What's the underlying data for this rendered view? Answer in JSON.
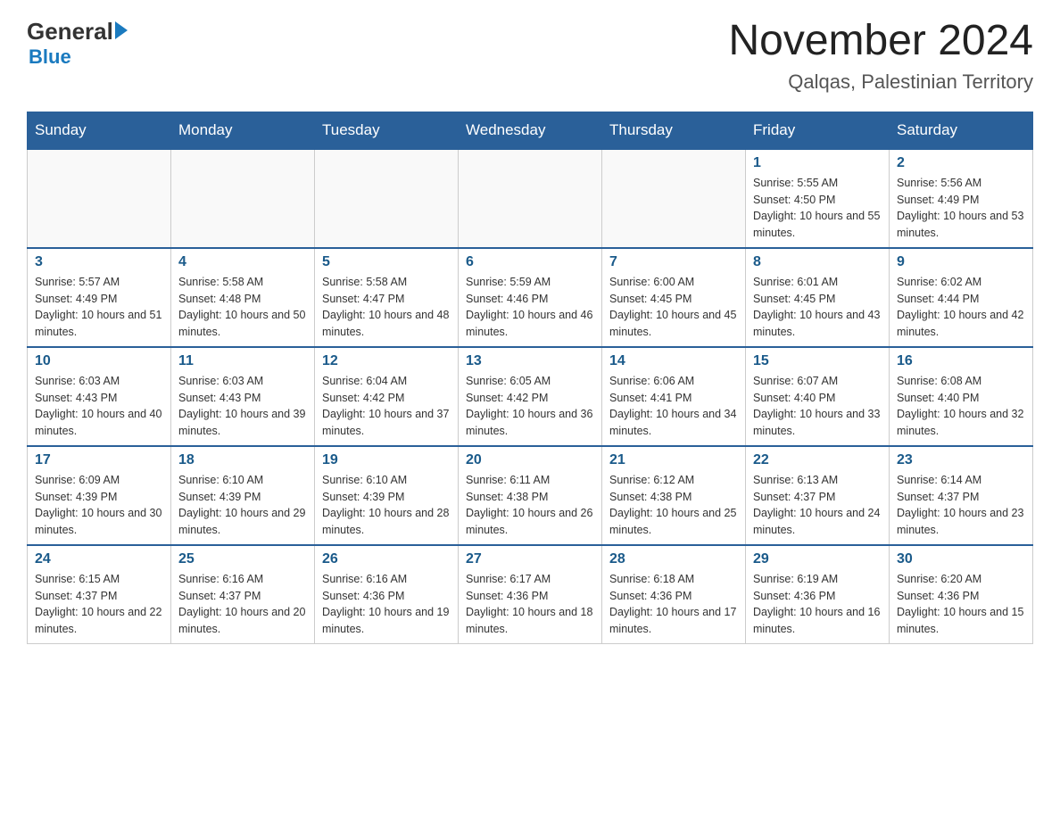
{
  "header": {
    "logo_general": "General",
    "logo_blue": "Blue",
    "title": "November 2024",
    "subtitle": "Qalqas, Palestinian Territory"
  },
  "calendar": {
    "days_of_week": [
      "Sunday",
      "Monday",
      "Tuesday",
      "Wednesday",
      "Thursday",
      "Friday",
      "Saturday"
    ],
    "weeks": [
      [
        {
          "day": "",
          "sunrise": "",
          "sunset": "",
          "daylight": ""
        },
        {
          "day": "",
          "sunrise": "",
          "sunset": "",
          "daylight": ""
        },
        {
          "day": "",
          "sunrise": "",
          "sunset": "",
          "daylight": ""
        },
        {
          "day": "",
          "sunrise": "",
          "sunset": "",
          "daylight": ""
        },
        {
          "day": "",
          "sunrise": "",
          "sunset": "",
          "daylight": ""
        },
        {
          "day": "1",
          "sunrise": "Sunrise: 5:55 AM",
          "sunset": "Sunset: 4:50 PM",
          "daylight": "Daylight: 10 hours and 55 minutes."
        },
        {
          "day": "2",
          "sunrise": "Sunrise: 5:56 AM",
          "sunset": "Sunset: 4:49 PM",
          "daylight": "Daylight: 10 hours and 53 minutes."
        }
      ],
      [
        {
          "day": "3",
          "sunrise": "Sunrise: 5:57 AM",
          "sunset": "Sunset: 4:49 PM",
          "daylight": "Daylight: 10 hours and 51 minutes."
        },
        {
          "day": "4",
          "sunrise": "Sunrise: 5:58 AM",
          "sunset": "Sunset: 4:48 PM",
          "daylight": "Daylight: 10 hours and 50 minutes."
        },
        {
          "day": "5",
          "sunrise": "Sunrise: 5:58 AM",
          "sunset": "Sunset: 4:47 PM",
          "daylight": "Daylight: 10 hours and 48 minutes."
        },
        {
          "day": "6",
          "sunrise": "Sunrise: 5:59 AM",
          "sunset": "Sunset: 4:46 PM",
          "daylight": "Daylight: 10 hours and 46 minutes."
        },
        {
          "day": "7",
          "sunrise": "Sunrise: 6:00 AM",
          "sunset": "Sunset: 4:45 PM",
          "daylight": "Daylight: 10 hours and 45 minutes."
        },
        {
          "day": "8",
          "sunrise": "Sunrise: 6:01 AM",
          "sunset": "Sunset: 4:45 PM",
          "daylight": "Daylight: 10 hours and 43 minutes."
        },
        {
          "day": "9",
          "sunrise": "Sunrise: 6:02 AM",
          "sunset": "Sunset: 4:44 PM",
          "daylight": "Daylight: 10 hours and 42 minutes."
        }
      ],
      [
        {
          "day": "10",
          "sunrise": "Sunrise: 6:03 AM",
          "sunset": "Sunset: 4:43 PM",
          "daylight": "Daylight: 10 hours and 40 minutes."
        },
        {
          "day": "11",
          "sunrise": "Sunrise: 6:03 AM",
          "sunset": "Sunset: 4:43 PM",
          "daylight": "Daylight: 10 hours and 39 minutes."
        },
        {
          "day": "12",
          "sunrise": "Sunrise: 6:04 AM",
          "sunset": "Sunset: 4:42 PM",
          "daylight": "Daylight: 10 hours and 37 minutes."
        },
        {
          "day": "13",
          "sunrise": "Sunrise: 6:05 AM",
          "sunset": "Sunset: 4:42 PM",
          "daylight": "Daylight: 10 hours and 36 minutes."
        },
        {
          "day": "14",
          "sunrise": "Sunrise: 6:06 AM",
          "sunset": "Sunset: 4:41 PM",
          "daylight": "Daylight: 10 hours and 34 minutes."
        },
        {
          "day": "15",
          "sunrise": "Sunrise: 6:07 AM",
          "sunset": "Sunset: 4:40 PM",
          "daylight": "Daylight: 10 hours and 33 minutes."
        },
        {
          "day": "16",
          "sunrise": "Sunrise: 6:08 AM",
          "sunset": "Sunset: 4:40 PM",
          "daylight": "Daylight: 10 hours and 32 minutes."
        }
      ],
      [
        {
          "day": "17",
          "sunrise": "Sunrise: 6:09 AM",
          "sunset": "Sunset: 4:39 PM",
          "daylight": "Daylight: 10 hours and 30 minutes."
        },
        {
          "day": "18",
          "sunrise": "Sunrise: 6:10 AM",
          "sunset": "Sunset: 4:39 PM",
          "daylight": "Daylight: 10 hours and 29 minutes."
        },
        {
          "day": "19",
          "sunrise": "Sunrise: 6:10 AM",
          "sunset": "Sunset: 4:39 PM",
          "daylight": "Daylight: 10 hours and 28 minutes."
        },
        {
          "day": "20",
          "sunrise": "Sunrise: 6:11 AM",
          "sunset": "Sunset: 4:38 PM",
          "daylight": "Daylight: 10 hours and 26 minutes."
        },
        {
          "day": "21",
          "sunrise": "Sunrise: 6:12 AM",
          "sunset": "Sunset: 4:38 PM",
          "daylight": "Daylight: 10 hours and 25 minutes."
        },
        {
          "day": "22",
          "sunrise": "Sunrise: 6:13 AM",
          "sunset": "Sunset: 4:37 PM",
          "daylight": "Daylight: 10 hours and 24 minutes."
        },
        {
          "day": "23",
          "sunrise": "Sunrise: 6:14 AM",
          "sunset": "Sunset: 4:37 PM",
          "daylight": "Daylight: 10 hours and 23 minutes."
        }
      ],
      [
        {
          "day": "24",
          "sunrise": "Sunrise: 6:15 AM",
          "sunset": "Sunset: 4:37 PM",
          "daylight": "Daylight: 10 hours and 22 minutes."
        },
        {
          "day": "25",
          "sunrise": "Sunrise: 6:16 AM",
          "sunset": "Sunset: 4:37 PM",
          "daylight": "Daylight: 10 hours and 20 minutes."
        },
        {
          "day": "26",
          "sunrise": "Sunrise: 6:16 AM",
          "sunset": "Sunset: 4:36 PM",
          "daylight": "Daylight: 10 hours and 19 minutes."
        },
        {
          "day": "27",
          "sunrise": "Sunrise: 6:17 AM",
          "sunset": "Sunset: 4:36 PM",
          "daylight": "Daylight: 10 hours and 18 minutes."
        },
        {
          "day": "28",
          "sunrise": "Sunrise: 6:18 AM",
          "sunset": "Sunset: 4:36 PM",
          "daylight": "Daylight: 10 hours and 17 minutes."
        },
        {
          "day": "29",
          "sunrise": "Sunrise: 6:19 AM",
          "sunset": "Sunset: 4:36 PM",
          "daylight": "Daylight: 10 hours and 16 minutes."
        },
        {
          "day": "30",
          "sunrise": "Sunrise: 6:20 AM",
          "sunset": "Sunset: 4:36 PM",
          "daylight": "Daylight: 10 hours and 15 minutes."
        }
      ]
    ]
  }
}
